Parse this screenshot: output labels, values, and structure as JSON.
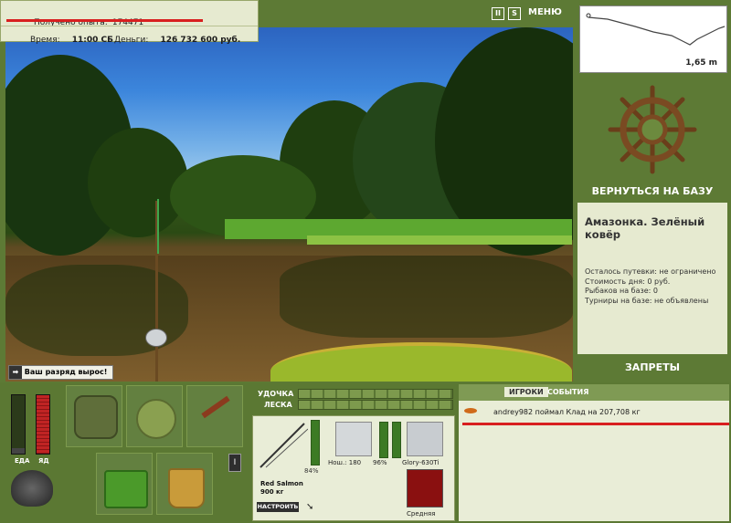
{
  "header": {
    "experience_label": "Получено опыта:",
    "experience_value": "174471",
    "time_label": "Время:",
    "time_value": "11:00 СБ",
    "money_label": "Деньги:",
    "money_value": "126 732 600 руб.",
    "menu_label": "МЕНЮ"
  },
  "depth": {
    "value": "1,65 m"
  },
  "notice": {
    "text": "Ваш разряд вырос!"
  },
  "sidebar": {
    "return_label": "ВЕРНУТЬСЯ НА БАЗУ",
    "location_title": "Амазонка. Зелёный ковёр",
    "info": [
      "Осталось путевки: не ограничено",
      "Стоимость дня: 0 руб.",
      "Рыбаков на базе: 0",
      "Турниры на базе: не объявлены"
    ],
    "bans_label": "ЗАПРЕТЫ"
  },
  "status": {
    "food_label": "ЕДА",
    "poison_label": "ЯД"
  },
  "tackle": {
    "rod_label": "УДОЧКА",
    "line_label": "ЛЕСКА",
    "rod_name": "Red Salmon",
    "rod_capacity": "900 кг",
    "rod_percent": "84%",
    "setup_label": "НАСТРОИТЬ",
    "reel_info": "Нош.: 180",
    "reel_percent": "96%",
    "line_name": "Glory-630Ti",
    "lure_name": "Средняя"
  },
  "events": {
    "tab_players": "ИГРОКИ",
    "tab_events": "СОБЫТИЯ",
    "feed": [
      "andrey982 поймал Клад на 207,708 кг"
    ]
  },
  "colors": {
    "accent_red": "#d81f1f",
    "panel_green": "#5d7a35",
    "panel_light": "#e6ead0"
  }
}
